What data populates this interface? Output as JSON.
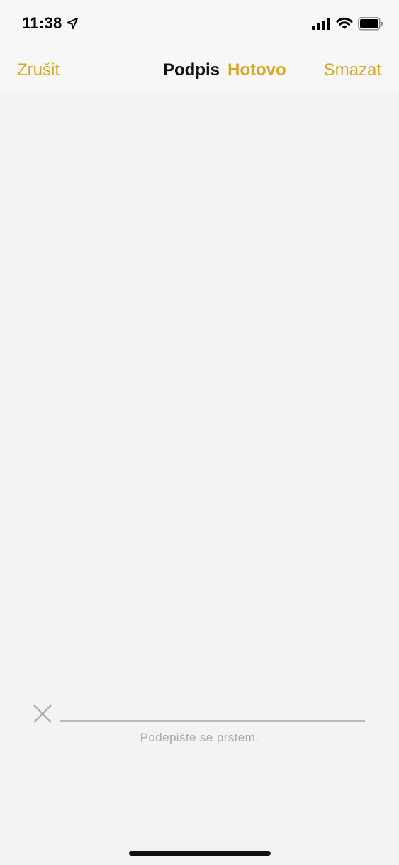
{
  "status": {
    "time": "11:38",
    "icons": [
      "location-arrow-icon",
      "signal-icon",
      "wifi-icon",
      "battery-icon"
    ]
  },
  "nav": {
    "cancel_label": "Zrušit",
    "title": "Podpis",
    "done_label": "Hotovo",
    "clear_label": "Smazat"
  },
  "signature": {
    "hint": "Podepište se prstem.",
    "marker_icon": "x-mark-icon"
  },
  "colors": {
    "accent": "#d8a825",
    "background": "#f3f3f2"
  }
}
